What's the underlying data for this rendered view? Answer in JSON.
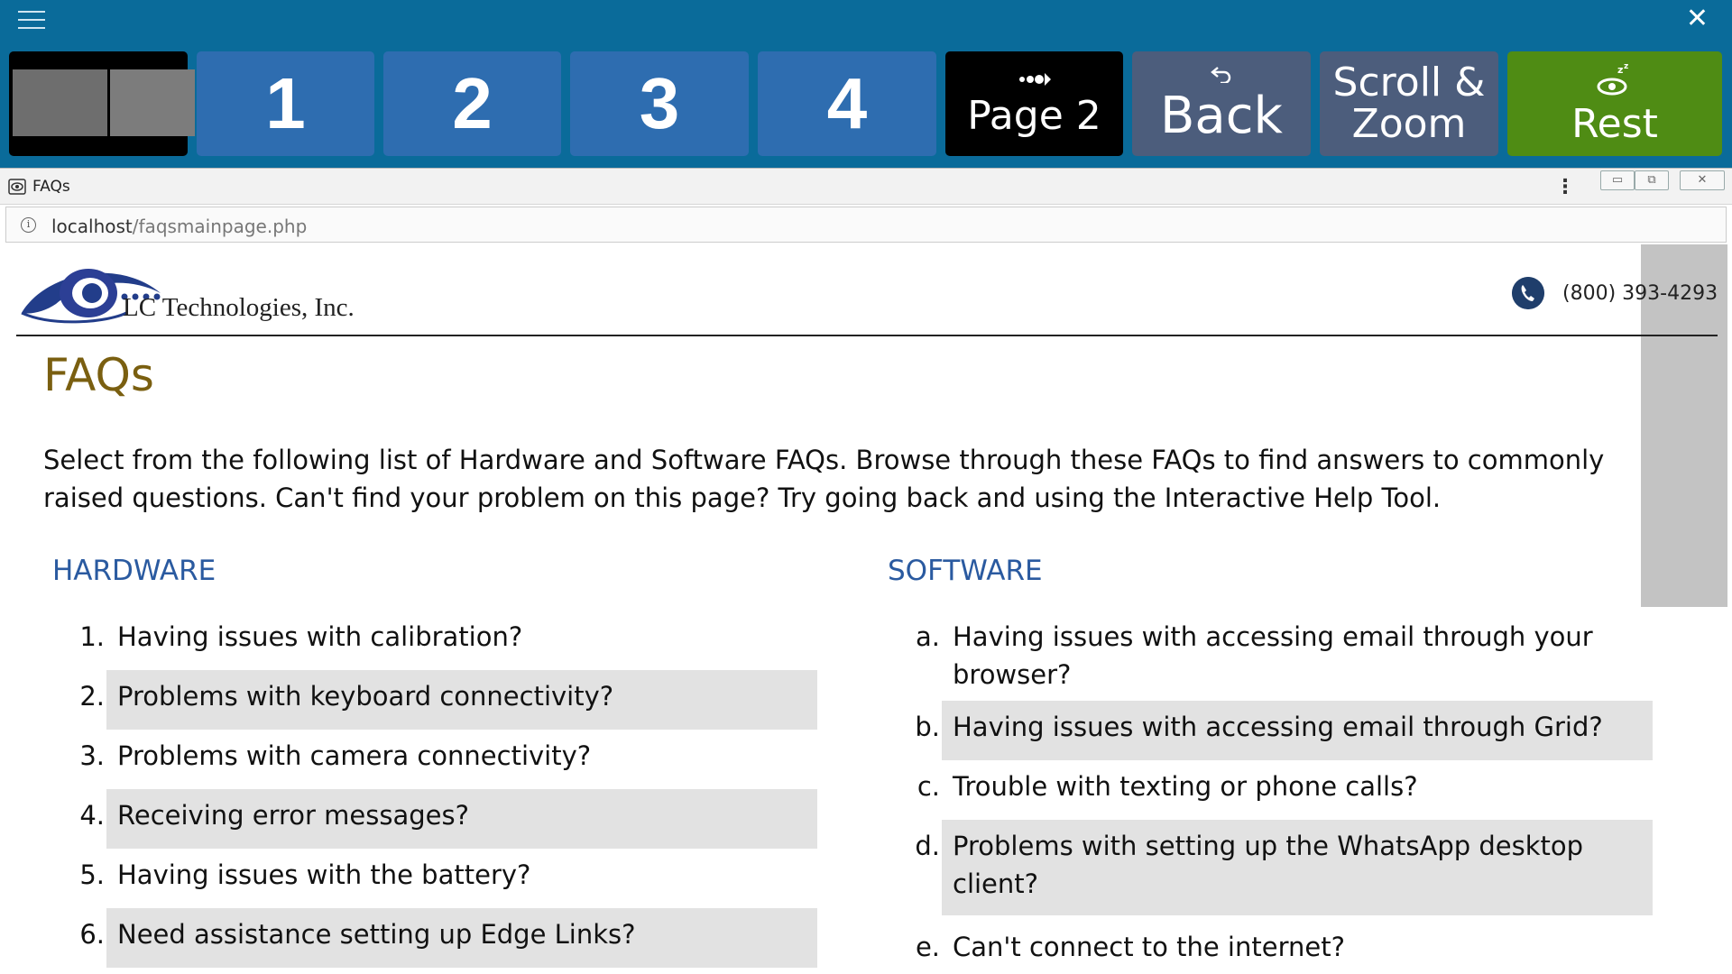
{
  "toolbar": {
    "menu_icon": "hamburger-icon",
    "close_icon": "close-icon",
    "tiles": {
      "t1": "1",
      "t2": "2",
      "t3": "3",
      "t4": "4",
      "page2": "Page 2",
      "back": "Back",
      "scroll_zoom_line1": "Scroll &",
      "scroll_zoom_line2": "Zoom",
      "rest": "Rest"
    },
    "colors": {
      "bar": "#0a6b9a",
      "number_tile": "#2e6db0",
      "page_tile": "#000000",
      "back_tile": "#4c5d7c",
      "rest_tile": "#4f8c14"
    }
  },
  "window": {
    "title": "FAQs",
    "url_host": "localhost",
    "url_path": "/faqsmainpage.php"
  },
  "page": {
    "company": "LC Technologies, Inc.",
    "phone": "(800) 393-4293",
    "heading": "FAQs",
    "intro": "Select from the following list of Hardware and Software FAQs. Browse through these FAQs to find answers to commonly raised questions. Can't find your problem on this page? Try going back and using the Interactive Help Tool.",
    "hardware_title": "HARDWARE",
    "software_title": "SOFTWARE",
    "hardware": [
      {
        "label": "1.",
        "text": "Having issues with calibration?"
      },
      {
        "label": "2.",
        "text": "Problems with keyboard connectivity?"
      },
      {
        "label": "3.",
        "text": "Problems with camera connectivity?"
      },
      {
        "label": "4.",
        "text": "Receiving error messages?"
      },
      {
        "label": "5.",
        "text": "Having issues with the battery?"
      },
      {
        "label": "6.",
        "text": "Need assistance setting up Edge Links?"
      }
    ],
    "software": [
      {
        "label": "a.",
        "line1": "Having issues with accessing email through your",
        "line2": "browser?"
      },
      {
        "label": "b.",
        "text": "Having issues with accessing email through Grid?"
      },
      {
        "label": "c.",
        "text": "Trouble with texting or phone calls?"
      },
      {
        "label": "d.",
        "line1": "Problems with setting up the WhatsApp desktop",
        "line2": "client?"
      },
      {
        "label": "e.",
        "text": "Can't connect to the internet?"
      }
    ]
  }
}
